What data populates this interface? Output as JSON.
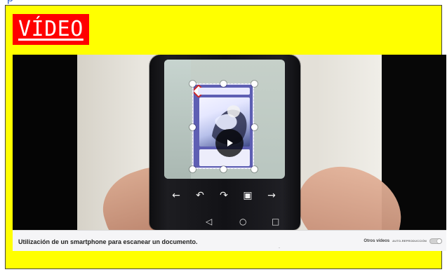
{
  "top_cut_text": "p",
  "title_badge": "VÍDEO",
  "video": {
    "caption": "Utilización de un smartphone para escanear un documento.",
    "other_videos": "Otros vídeos",
    "autoplay": "AUTO-REPRODUCCIÓN",
    "autoplay_enabled": false
  },
  "icons": {
    "play": "play-icon",
    "phone_back": "arrow-left-icon",
    "phone_rotate_left": "rotate-left-icon",
    "phone_rotate_right": "rotate-right-icon",
    "phone_image": "image-icon",
    "phone_next": "arrow-right-icon",
    "android_back": "triangle-back-icon",
    "android_home": "circle-home-icon",
    "android_recent": "square-recent-icon"
  },
  "colors": {
    "yellow": "#ffff00",
    "title_bg": "#ff0000",
    "title_text": "#ffffff"
  },
  "bottom_tiny_text": "·"
}
